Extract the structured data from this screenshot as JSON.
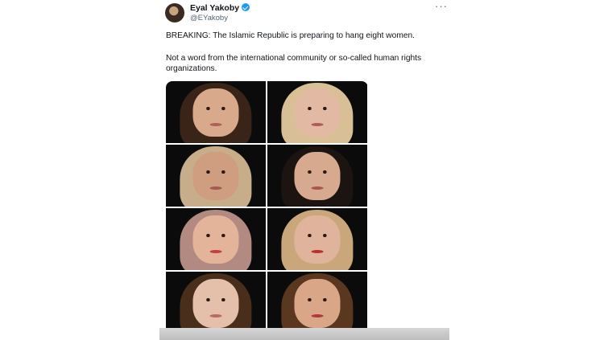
{
  "post": {
    "author_name": "Eyal Yakoby",
    "author_handle": "@EYakoby",
    "more_glyph": "···",
    "text_line1": "BREAKING: The Islamic Republic is preparing to hang eight women.",
    "text_line2": "Not a word from the international community or so-called human rights organizations."
  },
  "colors": {
    "verified": "#1d9bf0",
    "text": "#0f1419",
    "secondary_text": "#536471"
  },
  "icons": {
    "verified": "verified-badge-icon",
    "more": "more-options-icon"
  },
  "photos": [
    {
      "bg": "#0b0b0b",
      "hair": "#3a2417",
      "skin": "#d9a98c",
      "lips": "#b0605a"
    },
    {
      "bg": "#0b0b0b",
      "hair": "#d8bf96",
      "skin": "#e2b9a3",
      "lips": "#b05a5a"
    },
    {
      "bg": "#0b0b0b",
      "hair": "#c8ad8a",
      "skin": "#cf9d80",
      "lips": "#a25a52"
    },
    {
      "bg": "#0b0b0b",
      "hair": "#1c1410",
      "skin": "#d7a98f",
      "lips": "#a8544f"
    },
    {
      "bg": "#0b0b0b",
      "hair": "#b28a82",
      "skin": "#e3b39a",
      "lips": "#c0403e"
    },
    {
      "bg": "#0b0b0b",
      "hair": "#caa77a",
      "skin": "#e0b49c",
      "lips": "#b8302e"
    },
    {
      "bg": "#0b0b0b",
      "hair": "#4a2e1c",
      "skin": "#e4c0ab",
      "lips": "#b86a66"
    },
    {
      "bg": "#0b0b0b",
      "hair": "#5a3820",
      "skin": "#d9a688",
      "lips": "#b0383a"
    }
  ]
}
